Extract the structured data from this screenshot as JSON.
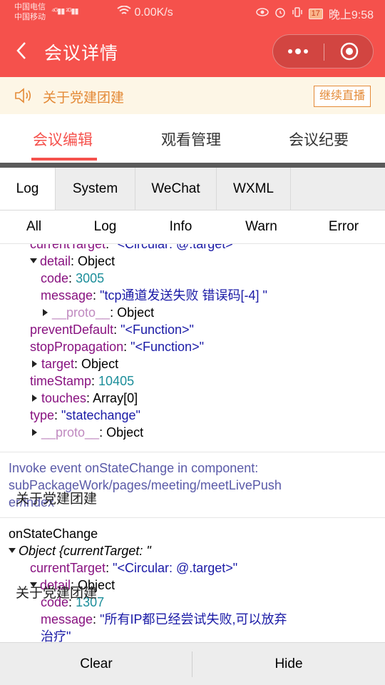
{
  "status_bar": {
    "carrier_1": "中国电信",
    "carrier_2": "中国移动",
    "signal_text": "⁴ᴳ▮▮ ²ᴳ▮▮",
    "network_speed": "0.00K/s",
    "battery": "17",
    "time": "晚上9:58"
  },
  "nav": {
    "title": "会议详情",
    "more_label": "•••"
  },
  "notice": {
    "text": "关于党建团建",
    "live_button": "继续直播"
  },
  "main_tabs": [
    {
      "label": "会议编辑",
      "active": true
    },
    {
      "label": "观看管理",
      "active": false
    },
    {
      "label": "会议纪要",
      "active": false
    }
  ],
  "console": {
    "tabs": [
      "Log",
      "System",
      "WeChat",
      "WXML"
    ],
    "filters": [
      "All",
      "Log",
      "Info",
      "Warn",
      "Error"
    ],
    "bottom": {
      "clear": "Clear",
      "hide": "Hide"
    }
  },
  "log": {
    "l1_key": "currentTarget",
    "l1_val": "\"<Circular: @.target>\"",
    "l2_key": "detail",
    "l2_val": "Object",
    "l3_key": "code",
    "l3_val": "3005",
    "l4_key": "message",
    "l4_val": "\"tcp通道发送失败 错误码[-4] \"",
    "l5_key": "__proto__",
    "l5_val": "Object",
    "l6_key": "preventDefault",
    "l6_val": "\"<Function>\"",
    "l7_key": "stopPropagation",
    "l7_val": "\"<Function>\"",
    "l8_key": "target",
    "l8_val": "Object",
    "l9_key": "timeStamp",
    "l9_val": "10405",
    "l10_key": "touches",
    "l10_val": "Array[0]",
    "l11_key": "type",
    "l11_val": "\"statechange\"",
    "l12_key": "__proto__",
    "l12_val": "Object",
    "info_1": "Invoke event onStateChange in component:",
    "info_2": "subPackageWork/pages/meeting/meetLivePush",
    "info_3": "er/index",
    "event_name": "onStateChange",
    "obj_head": "Object {currentTarget: \"",
    "e1_key": "currentTarget",
    "e1_val": "\"<Circular: @.target>\"",
    "e2_key": "detail",
    "e2_val": "Object",
    "e3_key": "code",
    "e3_val": "1307",
    "e4_key": "message",
    "e4_val": "\"所有IP都已经尝试失败,可以放弃",
    "e4_val_2": "治疗\""
  },
  "overlays": [
    "关于党建团建",
    "关于党建团建"
  ],
  "colors": {
    "brand_red": "#f5514c",
    "notice_orange": "#e48a37",
    "notice_bg": "#fdf6e6"
  },
  "icons": [
    "back-arrow-icon",
    "more-dots-icon",
    "close-circle-icon",
    "speaker-icon"
  ]
}
